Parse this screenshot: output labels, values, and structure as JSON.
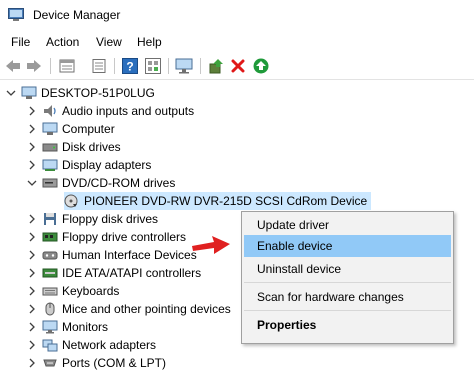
{
  "window": {
    "title": "Device Manager"
  },
  "menu": [
    "File",
    "Action",
    "View",
    "Help"
  ],
  "toolbar": [
    "back-icon",
    "forward-icon",
    "properties-icon",
    "update-icon",
    "help-icon",
    "show-hidden-icon",
    "monitor-icon",
    "add-driver-icon",
    "uninstall-icon",
    "enable-icon"
  ],
  "tree": {
    "root": "DESKTOP-51P0LUG",
    "items": [
      {
        "label": "Audio inputs and outputs",
        "icon": "speaker-icon"
      },
      {
        "label": "Computer",
        "icon": "computer-icon"
      },
      {
        "label": "Disk drives",
        "icon": "disk-icon"
      },
      {
        "label": "Display adapters",
        "icon": "display-adapter-icon"
      },
      {
        "label": "DVD/CD-ROM drives",
        "icon": "dvd-icon",
        "expanded": true
      },
      {
        "label": "PIONEER DVD-RW  DVR-215D SCSI CdRom Device",
        "icon": "dvd-device-icon",
        "child": true
      },
      {
        "label": "Floppy disk drives",
        "icon": "floppy-icon"
      },
      {
        "label": "Floppy drive controllers",
        "icon": "controller-icon"
      },
      {
        "label": "Human Interface Devices",
        "icon": "hid-icon"
      },
      {
        "label": "IDE ATA/ATAPI controllers",
        "icon": "ide-icon"
      },
      {
        "label": "Keyboards",
        "icon": "keyboard-icon"
      },
      {
        "label": "Mice and other pointing devices",
        "icon": "mouse-icon"
      },
      {
        "label": "Monitors",
        "icon": "monitor-icon"
      },
      {
        "label": "Network adapters",
        "icon": "network-icon"
      },
      {
        "label": "Ports (COM & LPT)",
        "icon": "port-icon"
      }
    ]
  },
  "context_menu": {
    "items": [
      {
        "label": "Update driver"
      },
      {
        "label": "Enable device",
        "highlighted": true
      },
      {
        "label": "Uninstall device"
      },
      {
        "label": "Scan for hardware changes"
      },
      {
        "label": "Properties",
        "bold": true
      }
    ]
  },
  "colors": {
    "selection": "#cce8ff",
    "menu_highlight": "#91c9f7",
    "arrow": "#e02020"
  }
}
